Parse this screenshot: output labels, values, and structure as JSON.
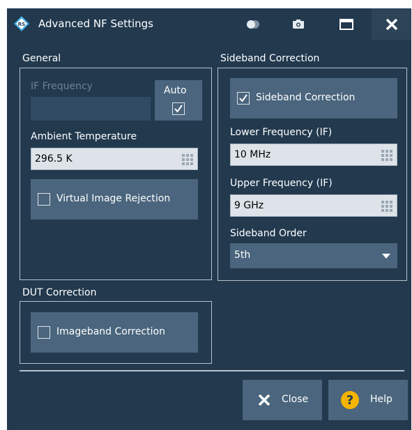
{
  "window": {
    "title": "Advanced NF Settings"
  },
  "titlebar": {
    "icons": [
      "rs-logo-icon",
      "toggle-icon",
      "camera-icon",
      "maximize-icon",
      "close-icon"
    ]
  },
  "general": {
    "section_label": "General",
    "if_frequency_label": "IF Frequency",
    "if_frequency_value": "",
    "auto_label": "Auto",
    "auto_checked": true,
    "ambient_temperature_label": "Ambient Temperature",
    "ambient_temperature_value": "296.5 K",
    "virtual_image_rejection_label": "Virtual Image Rejection",
    "virtual_image_rejection_checked": false
  },
  "sideband": {
    "section_label": "Sideband Correction",
    "sideband_correction_label": "Sideband Correction",
    "sideband_correction_checked": true,
    "lower_frequency_label": "Lower Frequency (IF)",
    "lower_frequency_value": "10 MHz",
    "upper_frequency_label": "Upper Frequency (IF)",
    "upper_frequency_value": "9 GHz",
    "sideband_order_label": "Sideband Order",
    "sideband_order_value": "5th"
  },
  "dut": {
    "section_label": "DUT Correction",
    "imageband_correction_label": "Imageband Correction",
    "imageband_correction_checked": false
  },
  "footer": {
    "close_label": "Close",
    "help_label": "Help"
  },
  "colors": {
    "window_bg": "#22394e",
    "button_bg": "#4a657d",
    "input_bg": "#dde3e8",
    "help_accent": "#f5b400"
  }
}
